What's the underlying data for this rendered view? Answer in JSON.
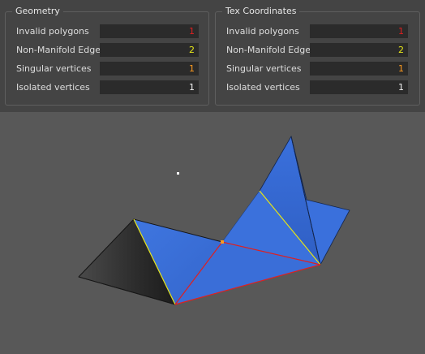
{
  "geometry": {
    "title": "Geometry",
    "rows": [
      {
        "label": "Invalid polygons",
        "value": "1",
        "color": "#e02020"
      },
      {
        "label": "Non-Manifold Edges",
        "value": "2",
        "color": "#e6e61a"
      },
      {
        "label": "Singular vertices",
        "value": "1",
        "color": "#ff9a1f"
      },
      {
        "label": "Isolated vertices",
        "value": "1",
        "color": "#f0f0f0"
      }
    ]
  },
  "tex_coordinates": {
    "title": "Tex Coordinates",
    "rows": [
      {
        "label": "Invalid polygons",
        "value": "1",
        "color": "#e02020"
      },
      {
        "label": "Non-Manifold Edges",
        "value": "2",
        "color": "#e6e61a"
      },
      {
        "label": "Singular vertices",
        "value": "1",
        "color": "#ff9a1f"
      },
      {
        "label": "Isolated vertices",
        "value": "1",
        "color": "#f0f0f0"
      }
    ]
  },
  "colors": {
    "panel_bg": "#444444",
    "viewport_bg": "#585858",
    "field_bg": "#2b2b2b",
    "face_blue": "#3a6fd8",
    "face_dark": "#2a2a2a",
    "edge_invalid": "#e02020",
    "edge_non_manifold": "#e6e61a",
    "vertex_singular": "#ff9a1f",
    "vertex_isolated": "#ffffff"
  }
}
